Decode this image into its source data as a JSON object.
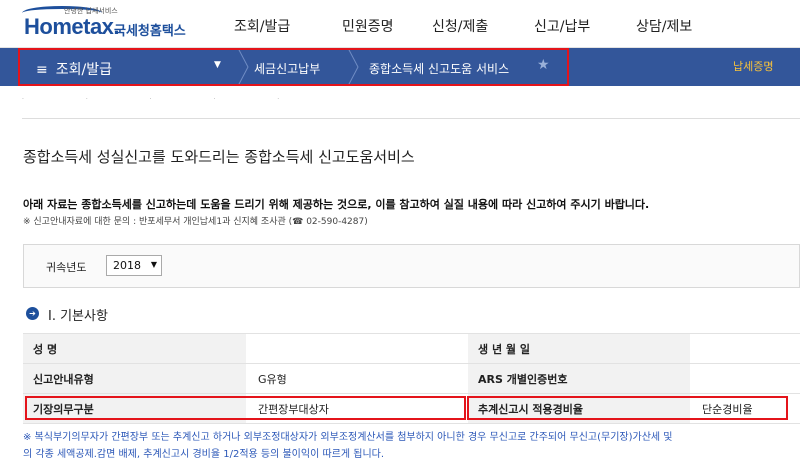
{
  "header": {
    "logo_small": "안녕한 납세서비스",
    "logo_main": "Hometax.",
    "logo_kr": "국세청홈택스",
    "gnb": [
      "조회/발급",
      "민원증명",
      "신청/제출",
      "신고/납부",
      "상담/제보"
    ]
  },
  "breadcrumb": {
    "menu": "조회/발급",
    "items": [
      "세금신고납부",
      "종합소득세 신고도움 서비스"
    ],
    "top_right": "납세증명"
  },
  "page": {
    "title": "종합소득세 성실신고를 도와드리는 종합소득세 신고도움서비스",
    "intro": "아래 자료는 종합소득세를 신고하는데 도움을 드리기 위해 제공하는 것으로, 이를 참고하여 실질 내용에 따라 신고하여 주시기 바랍니다.",
    "contact": "※ 신고안내자료에 대한 문의 : 반포세무서 개인납세1과 신지혜 조사관 (☎ 02-590-4287)"
  },
  "year": {
    "label": "귀속년도",
    "value": "2018"
  },
  "section": {
    "num": "I",
    "title": "Ⅰ. 기본사항"
  },
  "basic_info": {
    "rows": [
      [
        {
          "label": "성          명",
          "value": ""
        },
        {
          "label": "생  년  월  일",
          "value": ""
        }
      ],
      [
        {
          "label": "신고안내유형",
          "value": "G유형"
        },
        {
          "label": "ARS 개별인증번호",
          "value": ""
        }
      ],
      [
        {
          "label": "기장의무구분",
          "value": "간편장부대상자"
        },
        {
          "label": "추계신고시 적용경비율",
          "value": "단순경비율"
        }
      ]
    ]
  },
  "note": {
    "line1": "※ 복식부기의무자가 간편장부 또는 추계신고 하거나 외부조정대상자가 외부조정계산서를 첨부하지 아니한 경우 무신고로 간주되어 무신고(무기장)가산세 및",
    "line2": "의 각종 세액공제.감면 배제, 추계신고시 경비율 1/2적용 등의 불이익이 따르게 됩니다."
  }
}
